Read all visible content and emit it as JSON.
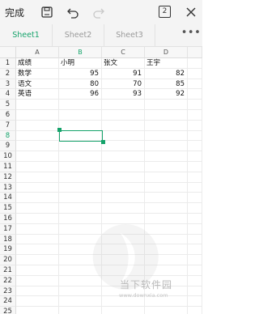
{
  "toolbar": {
    "done_label": "完成",
    "sheet_count": "2",
    "icons": [
      "save-icon",
      "undo-icon",
      "redo-icon",
      "sheets-count-icon",
      "close-icon"
    ]
  },
  "tabs": {
    "items": [
      {
        "label": "Sheet1",
        "active": true
      },
      {
        "label": "Sheet2",
        "active": false
      },
      {
        "label": "Sheet3",
        "active": false
      }
    ],
    "more_label": "•••"
  },
  "grid": {
    "columns": [
      "A",
      "B",
      "C",
      "D"
    ],
    "selected_column": "B",
    "rows": [
      "1",
      "2",
      "3",
      "4",
      "5",
      "6",
      "7",
      "8",
      "9",
      "10",
      "11",
      "12",
      "13",
      "14",
      "15",
      "16",
      "17",
      "18",
      "19",
      "20",
      "21",
      "22",
      "23",
      "24",
      "25"
    ],
    "selected_row": "8",
    "cells": [
      [
        "成绩",
        "小明",
        "张文",
        "王宇"
      ],
      [
        "数学",
        "95",
        "91",
        "82"
      ],
      [
        "语文",
        "80",
        "70",
        "85"
      ],
      [
        "英语",
        "96",
        "93",
        "92"
      ]
    ]
  },
  "watermark": {
    "text": "当下软件园",
    "url": "www.downxia.com"
  },
  "colors": {
    "accent": "#16a36b",
    "toolbar_bg": "#f4f4f4",
    "grid_line": "#ebebeb"
  }
}
